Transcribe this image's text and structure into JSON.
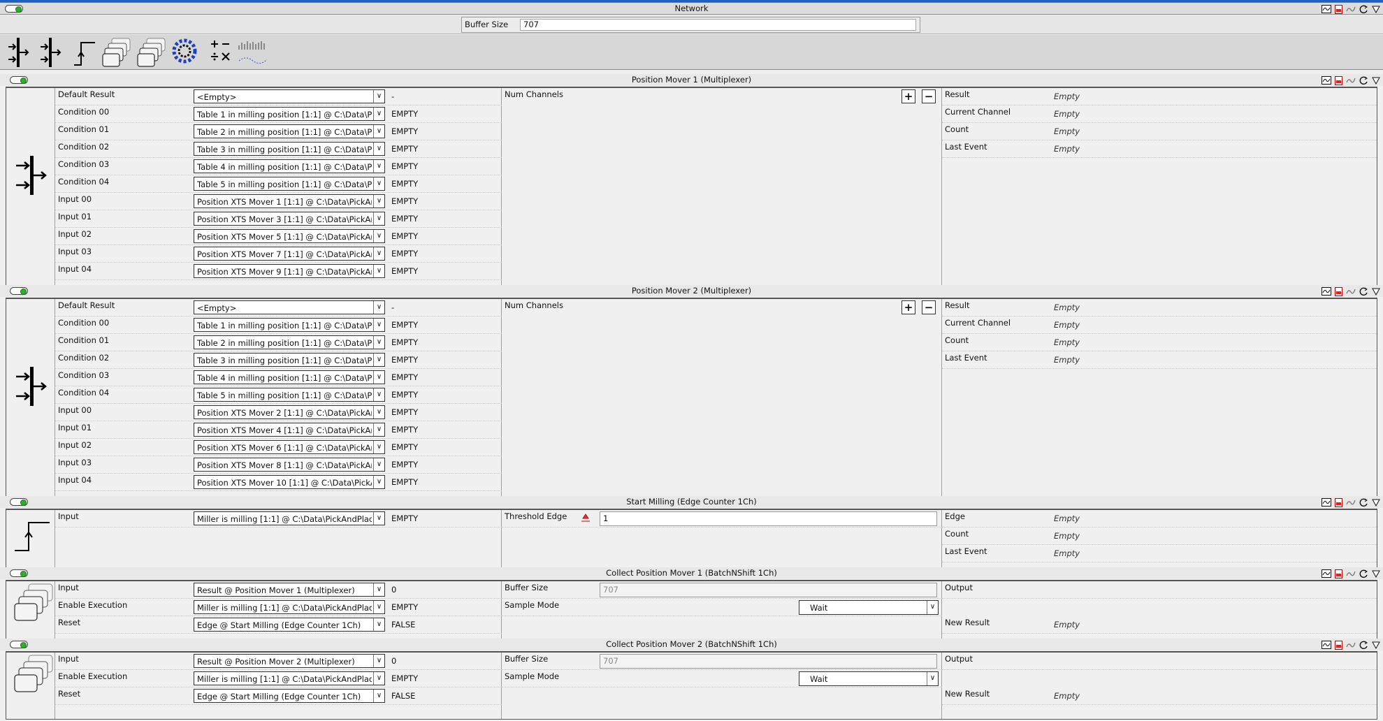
{
  "window": {
    "title": "Network"
  },
  "network": {
    "buffer_label": "Buffer Size",
    "buffer_value": "707"
  },
  "toolbar": {
    "icons": [
      "multiplexer-icon",
      "multiplexer-icon",
      "edge-counter-icon",
      "batch-shift-icon",
      "batch-shift-icon",
      "cycle-icon",
      "arithmetic-icon",
      "signal-icon"
    ]
  },
  "blocks": [
    {
      "title": "Position Mover 1 (Multiplexer)",
      "kind": "multiplexer",
      "rows": [
        {
          "label": "Default Result",
          "value": "<Empty>",
          "status": "-"
        },
        {
          "label": "Condition 00",
          "value": "Table 1 in milling position [1:1] @ C:\\Data\\Pic...",
          "status": "EMPTY"
        },
        {
          "label": "Condition 01",
          "value": "Table 2 in milling position [1:1] @ C:\\Data\\Pic...",
          "status": "EMPTY"
        },
        {
          "label": "Condition 02",
          "value": "Table 3 in milling position [1:1] @ C:\\Data\\Pic...",
          "status": "EMPTY"
        },
        {
          "label": "Condition 03",
          "value": "Table 4 in milling position [1:1] @ C:\\Data\\Pic...",
          "status": "EMPTY"
        },
        {
          "label": "Condition 04",
          "value": "Table 5 in milling position [1:1] @ C:\\Data\\Pic...",
          "status": "EMPTY"
        },
        {
          "label": "Input 00",
          "value": "Position XTS Mover 1 [1:1] @ C:\\Data\\PickAn...",
          "status": "EMPTY"
        },
        {
          "label": "Input 01",
          "value": "Position XTS Mover 3 [1:1] @ C:\\Data\\PickAn...",
          "status": "EMPTY"
        },
        {
          "label": "Input 02",
          "value": "Position XTS Mover 5 [1:1] @ C:\\Data\\PickAn...",
          "status": "EMPTY"
        },
        {
          "label": "Input 03",
          "value": "Position XTS Mover 7 [1:1] @ C:\\Data\\PickAn...",
          "status": "EMPTY"
        },
        {
          "label": "Input 04",
          "value": "Position XTS Mover 9 [1:1] @ C:\\Data\\PickAn...",
          "status": "EMPTY"
        }
      ],
      "mid": {
        "label": "Num Channels",
        "plus": "+",
        "minus": "−"
      },
      "outputs": [
        {
          "label": "Result",
          "value": "Empty"
        },
        {
          "label": "Current Channel",
          "value": "Empty"
        },
        {
          "label": "Count",
          "value": "Empty"
        },
        {
          "label": "Last Event",
          "value": "Empty"
        }
      ]
    },
    {
      "title": "Position Mover 2 (Multiplexer)",
      "kind": "multiplexer",
      "rows": [
        {
          "label": "Default Result",
          "value": "<Empty>",
          "status": "-"
        },
        {
          "label": "Condition 00",
          "value": "Table 1 in milling position [1:1] @ C:\\Data\\Pic...",
          "status": "EMPTY"
        },
        {
          "label": "Condition 01",
          "value": "Table 2 in milling position [1:1] @ C:\\Data\\Pic...",
          "status": "EMPTY"
        },
        {
          "label": "Condition 02",
          "value": "Table 3 in milling position [1:1] @ C:\\Data\\Pic...",
          "status": "EMPTY"
        },
        {
          "label": "Condition 03",
          "value": "Table 4 in milling position [1:1] @ C:\\Data\\Pic...",
          "status": "EMPTY"
        },
        {
          "label": "Condition 04",
          "value": "Table 5 in milling position [1:1] @ C:\\Data\\Pic...",
          "status": "EMPTY"
        },
        {
          "label": "Input 00",
          "value": "Position XTS Mover 2 [1:1] @ C:\\Data\\PickAn...",
          "status": "EMPTY"
        },
        {
          "label": "Input 01",
          "value": "Position XTS Mover 4 [1:1] @ C:\\Data\\PickAn...",
          "status": "EMPTY"
        },
        {
          "label": "Input 02",
          "value": "Position XTS Mover 6 [1:1] @ C:\\Data\\PickAn...",
          "status": "EMPTY"
        },
        {
          "label": "Input 03",
          "value": "Position XTS Mover 8 [1:1] @ C:\\Data\\PickAn...",
          "status": "EMPTY"
        },
        {
          "label": "Input 04",
          "value": "Position XTS Mover 10 [1:1] @ C:\\Data\\PickA...",
          "status": "EMPTY"
        }
      ],
      "mid": {
        "label": "Num Channels",
        "plus": "+",
        "minus": "−"
      },
      "outputs": [
        {
          "label": "Result",
          "value": "Empty"
        },
        {
          "label": "Current Channel",
          "value": "Empty"
        },
        {
          "label": "Count",
          "value": "Empty"
        },
        {
          "label": "Last Event",
          "value": "Empty"
        }
      ]
    },
    {
      "title": "Start Milling (Edge Counter 1Ch)",
      "kind": "edge",
      "rows": [
        {
          "label": "Input",
          "value": "Miller is milling [1:1] @ C:\\Data\\PickAndPlace...",
          "status": "EMPTY"
        }
      ],
      "mid": {
        "label": "Threshold Edge",
        "value": "1"
      },
      "outputs": [
        {
          "label": "Edge",
          "value": "Empty"
        },
        {
          "label": "Count",
          "value": "Empty"
        },
        {
          "label": "Last Event",
          "value": "Empty"
        }
      ]
    },
    {
      "title": "Collect Position Mover 1 (BatchNShift 1Ch)",
      "kind": "batch",
      "rows": [
        {
          "label": "Input",
          "value": "Result @ Position Mover 1 (Multiplexer)",
          "status": "0"
        },
        {
          "label": "Enable Execution",
          "value": "Miller is milling [1:1] @ C:\\Data\\PickAndPlace...",
          "status": "EMPTY"
        },
        {
          "label": "Reset",
          "value": "Edge @ Start Milling (Edge Counter 1Ch)",
          "status": "FALSE"
        }
      ],
      "mid": {
        "buffer_label": "Buffer Size",
        "buffer_value": "707",
        "mode_label": "Sample Mode",
        "mode_value": "Wait"
      },
      "outputs": [
        {
          "label": "Output",
          "value": ""
        },
        {
          "label": "",
          "value": ""
        },
        {
          "label": "New Result",
          "value": "Empty"
        }
      ]
    },
    {
      "title": "Collect Position Mover 2 (BatchNShift 1Ch)",
      "kind": "batch",
      "rows": [
        {
          "label": "Input",
          "value": "Result @ Position Mover 2 (Multiplexer)",
          "status": "0"
        },
        {
          "label": "Enable Execution",
          "value": "Miller is milling [1:1] @ C:\\Data\\PickAndPlace...",
          "status": "EMPTY"
        },
        {
          "label": "Reset",
          "value": "Edge @ Start Milling (Edge Counter 1Ch)",
          "status": "FALSE"
        }
      ],
      "mid": {
        "buffer_label": "Buffer Size",
        "buffer_value": "707",
        "mode_label": "Sample Mode",
        "mode_value": "Wait"
      },
      "outputs": [
        {
          "label": "Output",
          "value": ""
        },
        {
          "label": "",
          "value": ""
        },
        {
          "label": "New Result",
          "value": "Empty"
        }
      ]
    }
  ]
}
